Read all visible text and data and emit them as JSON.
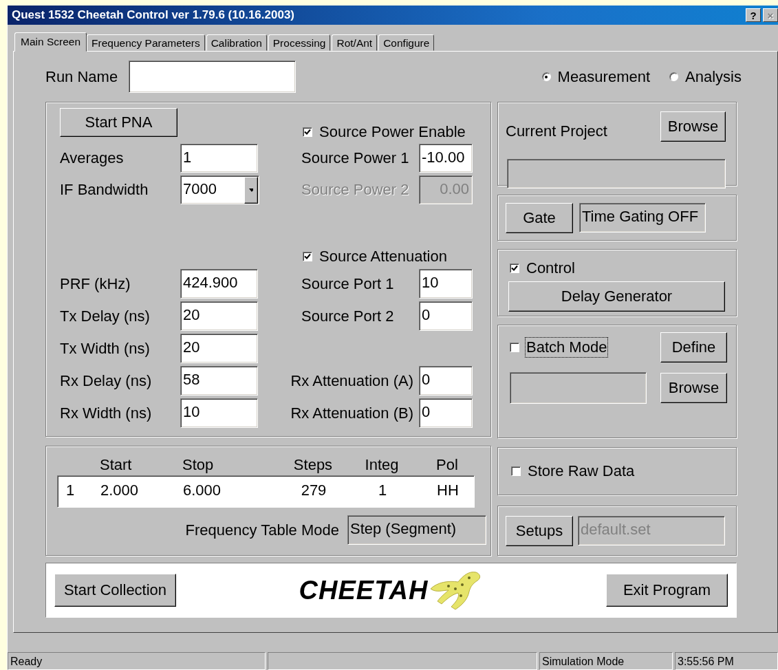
{
  "window": {
    "title": "Quest 1532 Cheetah Control ver 1.79.6 (10.16.2003)",
    "title_buttons": [
      {
        "label": "?",
        "disabled": false
      },
      {
        "label": "×",
        "disabled": true
      }
    ]
  },
  "tabs": [
    {
      "label": "Main Screen",
      "selected": true
    },
    {
      "label": "Frequency Parameters",
      "selected": false
    },
    {
      "label": "Calibration",
      "selected": false
    },
    {
      "label": "Processing",
      "selected": false
    },
    {
      "label": "Rot/Ant",
      "selected": false
    },
    {
      "label": "Configure",
      "selected": false
    }
  ],
  "run_name": {
    "label": "Run Name"
  },
  "mode_options": [
    {
      "label": "Measurement",
      "selected": true
    },
    {
      "label": "Analysis",
      "selected": false
    }
  ],
  "acquisition": {
    "start_button": {
      "label": "Start PNA"
    },
    "left_fields": [
      {
        "label": "Averages",
        "value": "1",
        "kind": "text"
      },
      {
        "label": "IF Bandwidth",
        "value": "7000",
        "kind": "dropdown"
      }
    ],
    "source_power": {
      "label": "Source Power Enable",
      "checked": true,
      "fields": [
        {
          "label": "Source Power 1",
          "value": "-10.00",
          "disabled": false
        },
        {
          "label": "Source Power 2",
          "value": "0.00",
          "disabled": true
        }
      ]
    },
    "source_attenuation": {
      "label": "Source Attenuation",
      "checked": true,
      "fields": [
        {
          "label": "Source Port 1",
          "value": "10"
        },
        {
          "label": "Source Port 2",
          "value": "0"
        }
      ]
    },
    "timing_fields": [
      {
        "label": "PRF (kHz)",
        "value": "424.900"
      },
      {
        "label": "Tx Delay (ns)",
        "value": "20"
      },
      {
        "label": "Tx Width (ns)",
        "value": "20"
      },
      {
        "label": "Rx Delay (ns)",
        "value": "58"
      },
      {
        "label": "Rx Width (ns)",
        "value": "10"
      }
    ],
    "rx_attenuation": [
      {
        "label": "Rx Attenuation (A)",
        "value": "0"
      },
      {
        "label": "Rx Attenuation (B)",
        "value": "0"
      }
    ]
  },
  "frequency_table": {
    "columns": [
      "Start",
      "Stop",
      "Steps",
      "Integ",
      "Pol"
    ],
    "rows": [
      {
        "index": "1",
        "cells": [
          "2.000",
          "6.000",
          "279",
          "1",
          "HH"
        ]
      }
    ],
    "mode_label": "Frequency Table Mode",
    "mode_value": "Step (Segment)"
  },
  "project": {
    "label": "Current Project",
    "browse": {
      "label": "Browse"
    }
  },
  "gate": {
    "button": {
      "label": "Gate"
    },
    "status": "Time Gating OFF"
  },
  "delay_control": {
    "label": "Control",
    "checked": true,
    "button": {
      "label": "Delay Generator"
    }
  },
  "batch": {
    "label": "Batch Mode",
    "checked": false,
    "focused": true,
    "define": {
      "label": "Define"
    },
    "browse": {
      "label": "Browse"
    }
  },
  "store_raw": {
    "label": "Store Raw Data",
    "checked": false
  },
  "setups": {
    "button": {
      "label": "Setups"
    },
    "file": "default.set",
    "file_disabled": true
  },
  "footer": {
    "start": {
      "label": "Start Collection"
    },
    "logo": "CHEETAH",
    "exit": {
      "label": "Exit Program"
    }
  },
  "status_bar": {
    "message": "Ready",
    "mode": "Simulation Mode",
    "time": "3:55:56 PM"
  }
}
